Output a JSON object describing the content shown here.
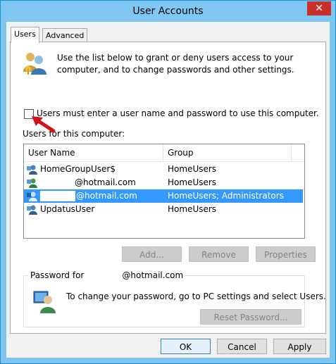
{
  "window": {
    "title": "User Accounts",
    "close_label": "✕"
  },
  "tabs": [
    {
      "label": "Users",
      "active": true
    },
    {
      "label": "Advanced",
      "active": false
    }
  ],
  "intro_text": "Use the list below to grant or deny users access to your computer, and to change passwords and other settings.",
  "require_login": {
    "label": "Users must enter a user name and password to use this computer.",
    "checked": false
  },
  "users_section_label": "Users for this computer:",
  "columns": [
    "User Name",
    "Group"
  ],
  "users": [
    {
      "name": "HomeGroupUser$",
      "group": "HomeUsers",
      "selected": false
    },
    {
      "name": "@hotmail.com",
      "group": "HomeUsers",
      "selected": false
    },
    {
      "name": "@hotmail.com",
      "group": "HomeUsers; Administrators",
      "selected": true
    },
    {
      "name": "UpdatusUser",
      "group": "HomeUsers",
      "selected": false
    }
  ],
  "list_buttons": {
    "add": "Add...",
    "remove": "Remove",
    "properties": "Properties"
  },
  "password_group": {
    "label_prefix": "Password for",
    "label_suffix": "@hotmail.com",
    "text": "To change your password, go to PC settings and select Users.",
    "reset_button": "Reset Password..."
  },
  "dialog_buttons": {
    "ok": "OK",
    "cancel": "Cancel",
    "apply": "Apply"
  },
  "colors": {
    "titlebar": "#7fc7f2",
    "selection": "#3399ff",
    "close": "#c7302b",
    "arrow": "#d0121b"
  }
}
